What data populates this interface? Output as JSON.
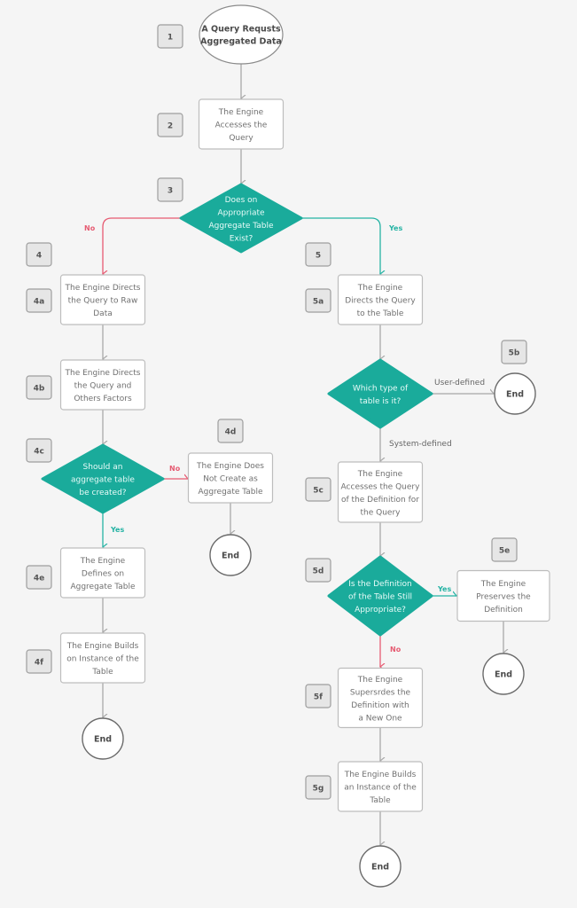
{
  "diagram": {
    "type": "flowchart",
    "colors": {
      "decision": "#1aab9b",
      "yes": "#25b3a4",
      "no": "#e65b72",
      "connector": "#a8a8a8",
      "background": "#f5f5f5"
    },
    "nodes": {
      "n1": {
        "step": "1",
        "shape": "ellipse",
        "lines": [
          "A Query Requsts",
          "Aggregated Data"
        ]
      },
      "n2": {
        "step": "2",
        "shape": "process",
        "lines": [
          "The Engine",
          "Accesses the",
          "Query"
        ]
      },
      "n3": {
        "step": "3",
        "shape": "decision",
        "lines": [
          "Does on",
          "Appropriate",
          "Aggregate Table",
          "Exist?"
        ]
      },
      "n4": {
        "step": "4"
      },
      "n4a": {
        "step": "4a",
        "shape": "process",
        "lines": [
          "The Engine Directs",
          "the Query to Raw",
          "Data"
        ]
      },
      "n4b": {
        "step": "4b",
        "shape": "process",
        "lines": [
          "The Engine Directs",
          "the Query and",
          "Others Factors"
        ]
      },
      "n4c": {
        "step": "4c",
        "shape": "decision",
        "lines": [
          "Should an",
          "aggregate table",
          "be created?"
        ]
      },
      "n4d": {
        "step": "4d",
        "shape": "process",
        "lines": [
          "The Engine Does",
          "Not Create as",
          "Aggregate Table"
        ]
      },
      "n4d_end": {
        "shape": "terminal",
        "label": "End"
      },
      "n4e": {
        "step": "4e",
        "shape": "process",
        "lines": [
          "The Engine",
          "Defines on",
          "Aggregate Table"
        ]
      },
      "n4f": {
        "step": "4f",
        "shape": "process",
        "lines": [
          "The Engine Builds",
          "on Instance of the",
          "Table"
        ]
      },
      "n4f_end": {
        "shape": "terminal",
        "label": "End"
      },
      "n5": {
        "step": "5"
      },
      "n5a": {
        "step": "5a",
        "shape": "process",
        "lines": [
          "The Engine",
          "Directs the Query",
          "to the Table"
        ]
      },
      "n5b": {
        "step": "5b",
        "shape": "decision",
        "lines": [
          "Which type of",
          "table is it?"
        ]
      },
      "n5b_end": {
        "shape": "terminal",
        "label": "End"
      },
      "n5c": {
        "step": "5c",
        "shape": "process",
        "lines": [
          "The Engine",
          "Accesses the Query",
          "of the Definition for",
          "the Query"
        ]
      },
      "n5d": {
        "step": "5d",
        "shape": "decision",
        "lines": [
          "Is the Definition",
          "of the Table Still",
          "Appropriate?"
        ]
      },
      "n5e": {
        "step": "5e",
        "shape": "process",
        "lines": [
          "The Engine",
          "Preserves the",
          "Definition"
        ]
      },
      "n5e_end": {
        "shape": "terminal",
        "label": "End"
      },
      "n5f": {
        "step": "5f",
        "shape": "process",
        "lines": [
          "The Engine",
          "Supersrdes the",
          "Definition with",
          "a New One"
        ]
      },
      "n5g": {
        "step": "5g",
        "shape": "process",
        "lines": [
          "The Engine Builds",
          "an Instance of the",
          "Table"
        ]
      },
      "n5g_end": {
        "shape": "terminal",
        "label": "End"
      }
    },
    "edges": [
      {
        "from": "n1",
        "to": "n2",
        "label": ""
      },
      {
        "from": "n2",
        "to": "n3",
        "label": ""
      },
      {
        "from": "n3",
        "to": "n4a",
        "label": "No"
      },
      {
        "from": "n3",
        "to": "n5a",
        "label": "Yes"
      },
      {
        "from": "n4a",
        "to": "n4b",
        "label": ""
      },
      {
        "from": "n4b",
        "to": "n4c",
        "label": ""
      },
      {
        "from": "n4c",
        "to": "n4d",
        "label": "No"
      },
      {
        "from": "n4c",
        "to": "n4e",
        "label": "Yes"
      },
      {
        "from": "n4d",
        "to": "n4d_end",
        "label": ""
      },
      {
        "from": "n4e",
        "to": "n4f",
        "label": ""
      },
      {
        "from": "n4f",
        "to": "n4f_end",
        "label": ""
      },
      {
        "from": "n5a",
        "to": "n5b",
        "label": ""
      },
      {
        "from": "n5b",
        "to": "n5b_end",
        "label": "User-defined"
      },
      {
        "from": "n5b",
        "to": "n5c",
        "label": "System-defined"
      },
      {
        "from": "n5c",
        "to": "n5d",
        "label": ""
      },
      {
        "from": "n5d",
        "to": "n5e",
        "label": "Yes"
      },
      {
        "from": "n5d",
        "to": "n5f",
        "label": "No"
      },
      {
        "from": "n5e",
        "to": "n5e_end",
        "label": ""
      },
      {
        "from": "n5f",
        "to": "n5g",
        "label": ""
      },
      {
        "from": "n5g",
        "to": "n5g_end",
        "label": ""
      }
    ],
    "edge_labels": {
      "no_3": "No",
      "yes_3": "Yes",
      "no_4c": "No",
      "yes_4c": "Yes",
      "user_defined": "User-defined",
      "system_defined": "System-defined",
      "yes_5d": "Yes",
      "no_5d": "No"
    }
  }
}
